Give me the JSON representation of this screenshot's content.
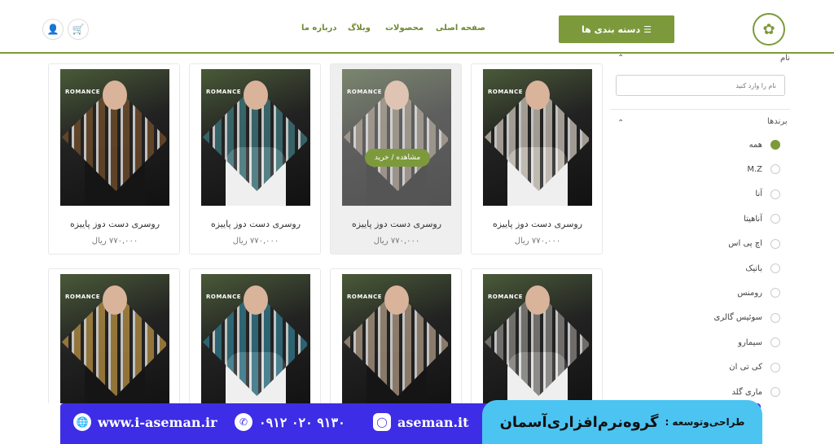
{
  "header": {
    "logo_icon": "leaf-logo-icon",
    "category_button": "دسته بندی ها",
    "nav": [
      "صفحه اصلی",
      "محصولات",
      "وبلاگ",
      "درباره ما"
    ],
    "cart_icon": "cart-icon",
    "user_icon": "user-icon"
  },
  "sidebar": {
    "name_filter": {
      "title": "نام",
      "placeholder": "نام را وارد کنید"
    },
    "brand_filter": {
      "title": "برندها",
      "options": [
        {
          "label": "همه",
          "selected": true
        },
        {
          "label": "M.Z",
          "selected": false
        },
        {
          "label": "آنا",
          "selected": false
        },
        {
          "label": "آناهیتا",
          "selected": false
        },
        {
          "label": "اچ پی اس",
          "selected": false
        },
        {
          "label": "باتیک",
          "selected": false
        },
        {
          "label": "رومنس",
          "selected": false
        },
        {
          "label": "سوئیس گالری",
          "selected": false
        },
        {
          "label": "سیمارو",
          "selected": false
        },
        {
          "label": "کی تی ان",
          "selected": false
        },
        {
          "label": "ماری گلد",
          "selected": false
        }
      ]
    }
  },
  "products": [
    {
      "title": "روسری دست دوز پاییزه",
      "price": "۷۷۰,۰۰۰ ریال",
      "brand_mark": "ROMANCE",
      "hover": false
    },
    {
      "title": "روسری دست دوز پاییزه",
      "price": "۷۷۰,۰۰۰ ریال",
      "brand_mark": "ROMANCE",
      "hover": true
    },
    {
      "title": "روسری دست دوز پاییزه",
      "price": "۷۷۰,۰۰۰ ریال",
      "brand_mark": "ROMANCE",
      "hover": false
    },
    {
      "title": "روسری دست دوز پاییزه",
      "price": "۷۷۰,۰۰۰ ریال",
      "brand_mark": "ROMANCE",
      "hover": false
    },
    {
      "title": "",
      "price": "",
      "brand_mark": "ROMANCE",
      "hover": false
    },
    {
      "title": "",
      "price": "",
      "brand_mark": "ROMANCE",
      "hover": false
    },
    {
      "title": "",
      "price": "",
      "brand_mark": "ROMANCE",
      "hover": false
    },
    {
      "title": "",
      "price": "",
      "brand_mark": "ROMANCE",
      "hover": false
    }
  ],
  "hover_button": "مشاهده / خرید",
  "banner": {
    "company_prefix": "طراحی‌وتوسعه :",
    "company_name": "گروه‌نرم‌افزاری‌آسمان",
    "instagram": "aseman.it",
    "phone": "۰۹۱۲ ۰۲۰ ۹۱۳۰",
    "website": "www.i-aseman.ir"
  },
  "colors": {
    "accent": "#7c9a3b",
    "banner_blue": "#3d2de6",
    "banner_cyan": "#4cc4f2"
  }
}
